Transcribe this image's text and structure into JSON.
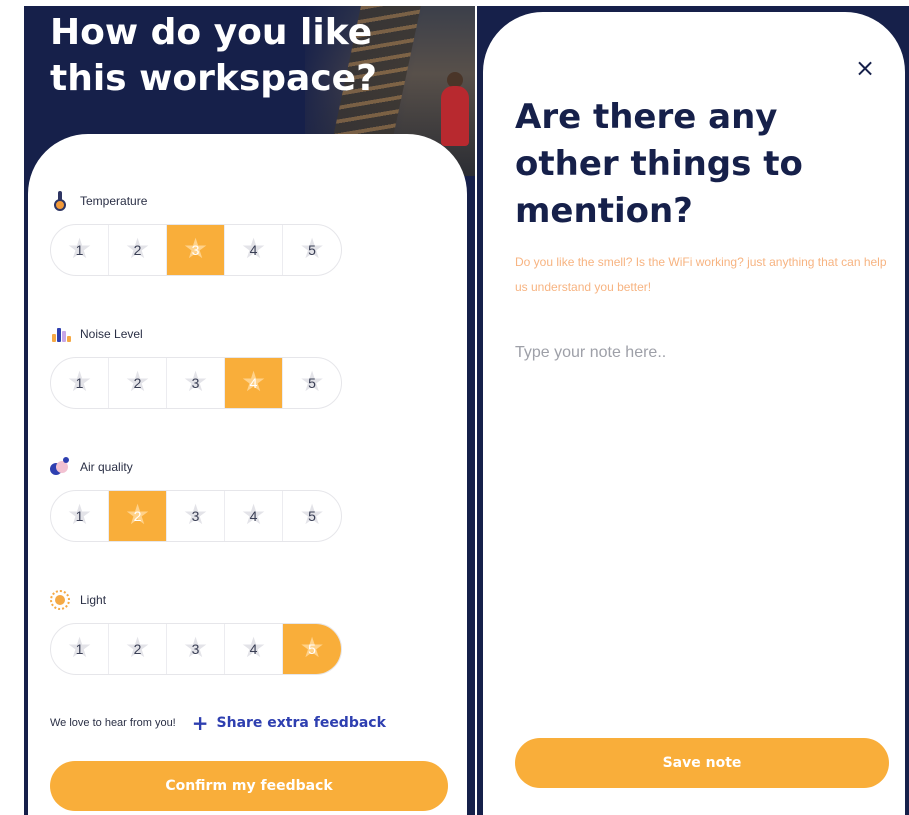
{
  "colors": {
    "navy": "#16204a",
    "accent_orange": "#f9ae3a",
    "link_blue": "#2e3fb0",
    "hint_peach": "#f7b482"
  },
  "feedback_screen": {
    "title": "How do you like this workspace?",
    "categories": [
      {
        "label": "Temperature",
        "icon": "thermometer-icon",
        "options": [
          "1",
          "2",
          "3",
          "4",
          "5"
        ],
        "selected": 3
      },
      {
        "label": "Noise Level",
        "icon": "noise-level-icon",
        "options": [
          "1",
          "2",
          "3",
          "4",
          "5"
        ],
        "selected": 4
      },
      {
        "label": "Air quality",
        "icon": "air-quality-icon",
        "options": [
          "1",
          "2",
          "3",
          "4",
          "5"
        ],
        "selected": 2
      },
      {
        "label": "Light",
        "icon": "sun-icon",
        "options": [
          "1",
          "2",
          "3",
          "4",
          "5"
        ],
        "selected": 5
      }
    ],
    "share_prompt": "We love to hear from you!",
    "share_link": "Share extra feedback",
    "confirm_button": "Confirm my feedback"
  },
  "note_screen": {
    "close_symbol": "×",
    "title": "Are there any other things to mention?",
    "hint": "Do you like the smell? Is the WiFi working? just anything that can help us understand you better!",
    "input_placeholder": "Type your note here..",
    "input_value": "",
    "save_button": "Save note"
  }
}
